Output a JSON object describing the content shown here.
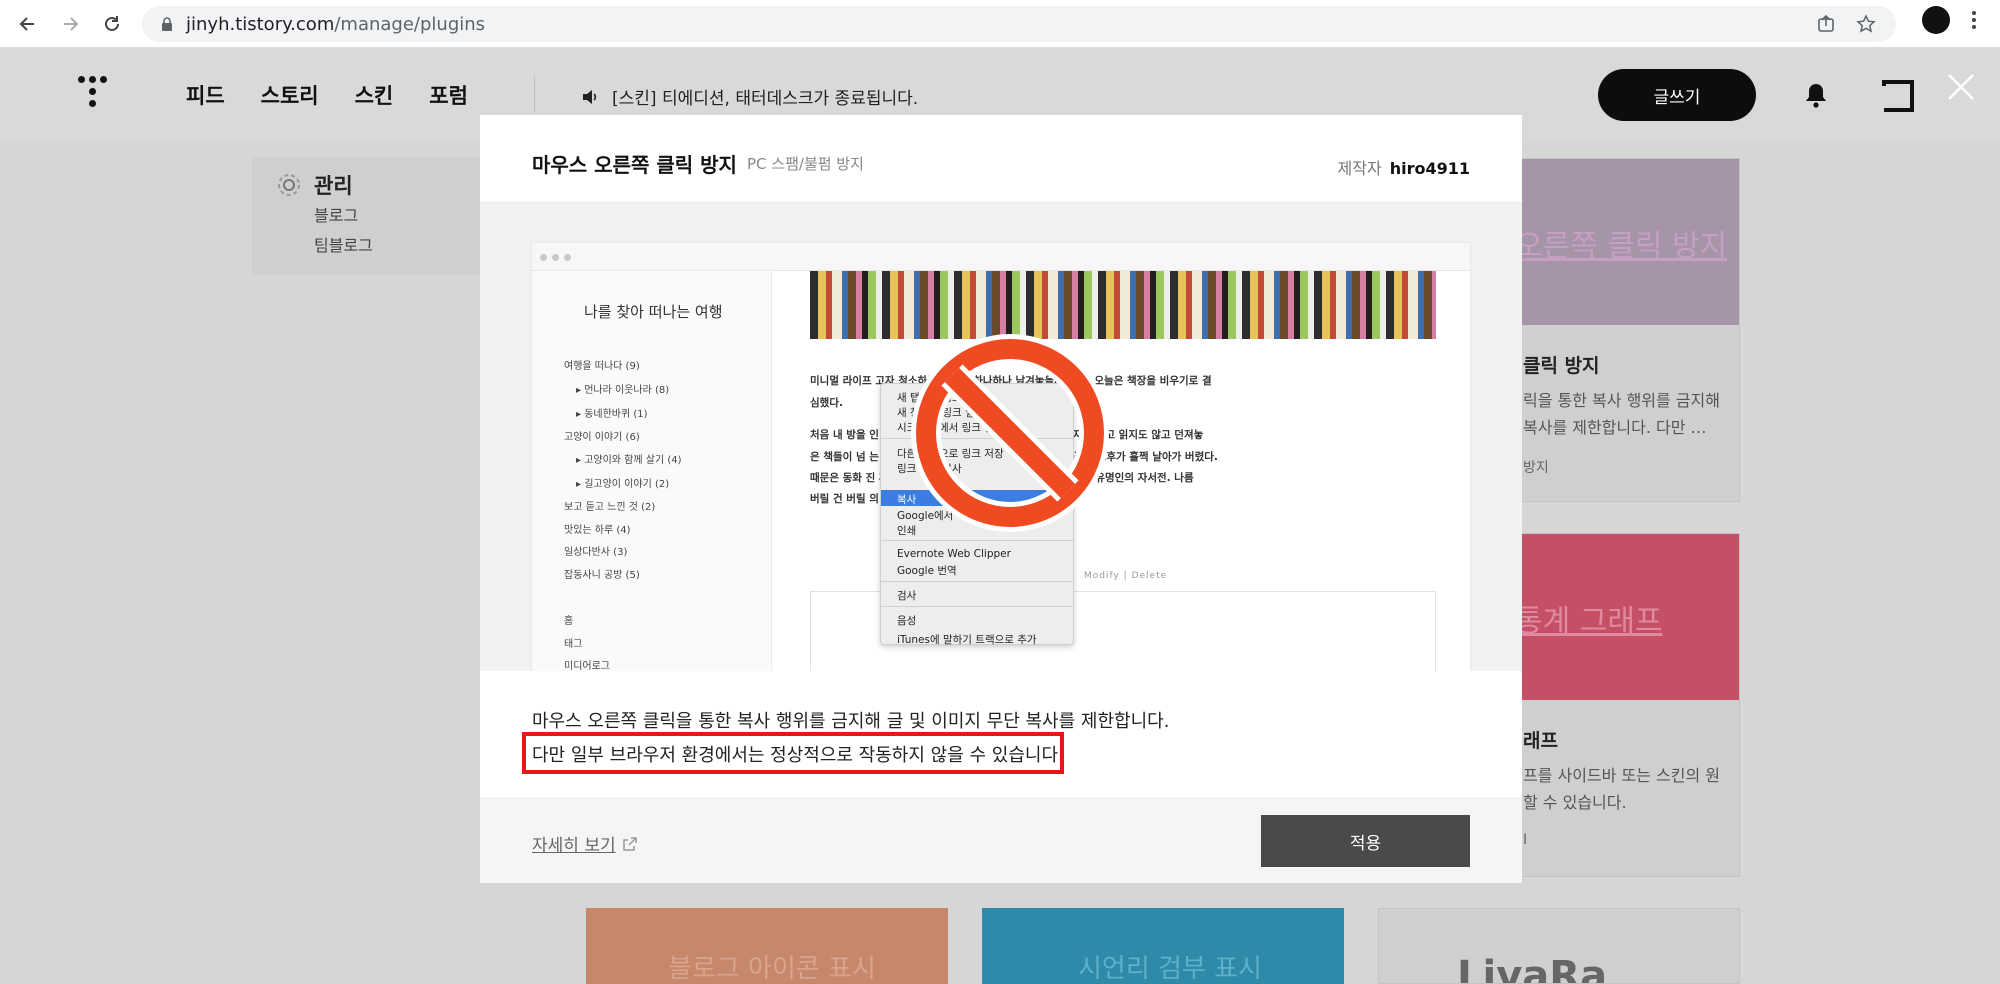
{
  "browser": {
    "url_host": "jinyh.tistory.com",
    "url_path": "/manage/plugins"
  },
  "header": {
    "nav": [
      "피드",
      "스토리",
      "스킨",
      "포럼"
    ],
    "notice": "[스킨] 티에디션, 태터데스크가 종료됩니다.",
    "write_label": "글쓰기"
  },
  "sidebar": {
    "title": "관리",
    "items": [
      "블로그",
      "팀블로그"
    ]
  },
  "bg_cards": {
    "card1": {
      "banner": "오른쪽 클릭 방지",
      "title": "클릭 방지",
      "desc1": "릭을 통한 복사 행위를 금지해",
      "desc2": "복사를 제한합니다. 다만 …",
      "tag": "방지"
    },
    "card2": {
      "banner": "통계 그래프",
      "title": "래프",
      "desc1": "프를 사이드바 또는 스킨의 원",
      "desc2": "할 수 있습니다.",
      "tag": "I"
    },
    "card3": {
      "banner": "블로그 아이콘 표시"
    },
    "card4": {
      "banner": "시언리 검부 표시"
    },
    "card5": {
      "banner": "LivaRa"
    }
  },
  "modal": {
    "title": "마우스 오른쪽 클릭 방지",
    "subtitle": "PC 스팸/불펌 방지",
    "maker_label": "제작자",
    "maker_name": "hiro4911",
    "description_line1": "마우스 오른쪽 클릭을 통한 복사 행위를 금지해 글 및 이미지 무단 복사를 제한합니다.",
    "description_line2": "다만 일부 브라우저 환경에서는 정상적으로 작동하지 않을 수 있습니다.",
    "more_link": "자세히 보기",
    "apply_label": "적용"
  },
  "preview": {
    "blog_title": "나를 찾아 떠나는 여행",
    "categories": [
      "여행을 떠나다 (9)",
      "▸ 먼나라 이웃나라 (8)",
      "▸ 동네한바퀴 (1)",
      "고양이 이야기 (6)",
      "▸ 고양이와 함께 살기 (4)",
      "▸ 길고양이 이야기 (2)",
      "보고 듣고 느낀 것 (2)",
      "맛있는 하루 (4)",
      "일상다반사 (3)",
      "잡동사니 공방 (5)"
    ],
    "links": [
      "홈",
      "태그",
      "미디어로그"
    ],
    "post_lines": [
      "미니멀 라이프                                                                     고자 청소하는 과정을 하나하나 남겨놓을까 한다. 오늘은 책장을 비우기로 결",
      "심했다.",
      "처음 내 방을                                                    인 오         서재의 이미지였을 텐데. 몇 년간 정리하지는 않고 읽지도 않고 던져놓",
      "은 책들이 넘                                                     는 기        로 책을 한 권 두 권 꺼내 분류하다 보니 주말 오후가 훌쩍 날아가 버렸다.",
      "때문은 동화                                                       진         후감 숙제 때문에 한 번 읽고 펼쳐보지 않은 어느 유명인의 자서전. 나름",
      "버릴 건 버릴                                                                  의 양을 줄이야."
    ],
    "modify_delete": "Modify  |  Delete",
    "context_menu": [
      "새 탭에서 링크 열기",
      "새 창에서 링크 열기",
      "시크릿 창에서 링크 열기",
      "다른 이름으로 링크 저장",
      "링크 주소 복사",
      "복사",
      "Google에서 '미니멀 라이프' 검색",
      "인쇄",
      "Evernote Web Clipper",
      "Google 번역",
      "검사",
      "음성",
      "iTunes에 말하기 트랙으로 추가"
    ]
  },
  "colors": {
    "accent_red": "#e31919",
    "dark_button": "#4a4a4a",
    "write_button": "#0d0d0d"
  }
}
